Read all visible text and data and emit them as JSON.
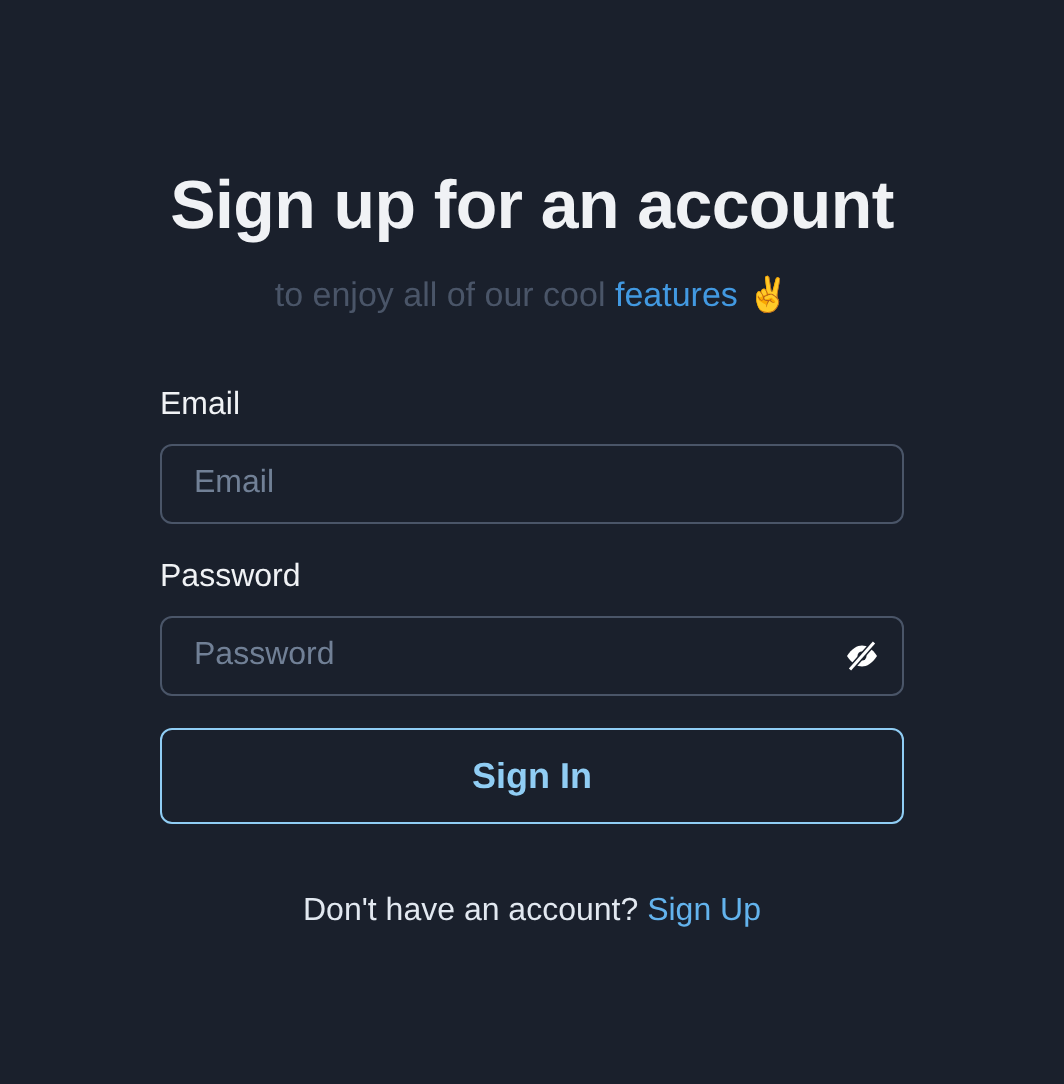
{
  "heading": {
    "title": "Sign up for an account",
    "subtitle": {
      "text": "to enjoy all of our cool ",
      "link": "features",
      "suffix": " ✌️"
    }
  },
  "fields": [
    {
      "label": "Email",
      "placeholder": "Email",
      "kind": "text"
    },
    {
      "label": "Password",
      "placeholder": "Password",
      "kind": "password"
    }
  ],
  "submit_button": "Sign In",
  "footer": {
    "text": "Don't have an account? ",
    "link": "Sign Up"
  }
}
